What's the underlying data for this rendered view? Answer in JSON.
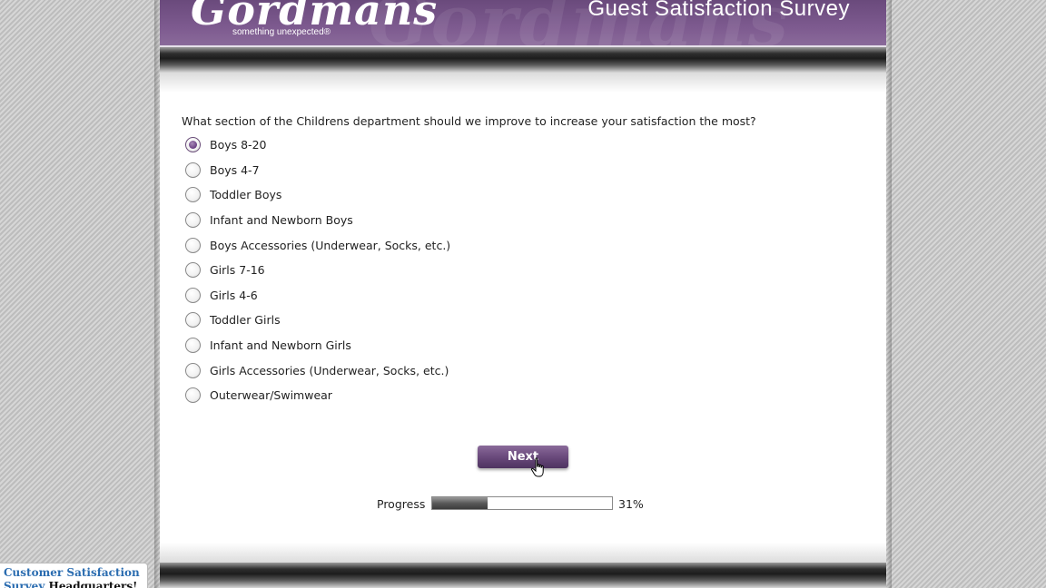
{
  "header": {
    "logo_text": "Gordmans",
    "logo_tagline": "something unexpected®",
    "survey_title": "Guest Satisfaction Survey"
  },
  "question": {
    "text": "What section of the Childrens department should we improve to increase your satisfaction the most?",
    "options": [
      {
        "label": "Boys 8-20",
        "selected": true
      },
      {
        "label": "Boys 4-7",
        "selected": false
      },
      {
        "label": "Toddler Boys",
        "selected": false
      },
      {
        "label": "Infant and Newborn Boys",
        "selected": false
      },
      {
        "label": "Boys Accessories (Underwear, Socks, etc.)",
        "selected": false
      },
      {
        "label": "Girls 7-16",
        "selected": false
      },
      {
        "label": "Girls 4-6",
        "selected": false
      },
      {
        "label": "Toddler Girls",
        "selected": false
      },
      {
        "label": "Infant and Newborn Girls",
        "selected": false
      },
      {
        "label": "Girls Accessories (Underwear, Socks, etc.)",
        "selected": false
      },
      {
        "label": "Outerwear/Swimwear",
        "selected": false
      }
    ]
  },
  "next_button": {
    "label": "Next"
  },
  "progress": {
    "label": "Progress",
    "percent_text": "31%",
    "fraction": 0.31
  },
  "watermark": {
    "line1": "Customer Satisfaction",
    "line2_part1": "Survey",
    "line2_part2": "Headquarters!"
  },
  "colors": {
    "brand_purple": "#6a4a7c",
    "page_bg": "#ffffff"
  },
  "icons": {
    "cursor": "hand-pointer-icon"
  }
}
